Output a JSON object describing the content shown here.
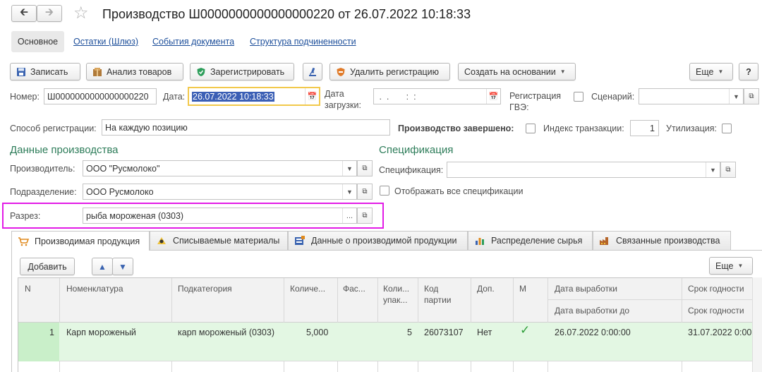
{
  "window": {
    "title": "Производство Ш0000000000000000220 от 26.07.2022 10:18:33"
  },
  "nav": {
    "tabs": [
      "Основное",
      "Остатки (Шлюз)",
      "События документа",
      "Структура подчиненности"
    ]
  },
  "toolbar": {
    "save": "Записать",
    "analyze": "Анализ товаров",
    "register": "Зарегистрировать",
    "unregister": "Удалить регистрацию",
    "create_based": "Создать на основании",
    "more": "Еще",
    "help": "?"
  },
  "form": {
    "number_label": "Номер:",
    "number_value": "Ш0000000000000000220",
    "date_label": "Дата:",
    "date_value": "26.07.2022 10:18:33",
    "load_date_label_1": "Дата",
    "load_date_label_2": "загрузки:",
    "load_date_value": " .  .       :  :",
    "gve_label_1": "Регистрация",
    "gve_label_2": "ГВЭ:",
    "scenario_label": "Сценарий:",
    "scenario_value": "",
    "reg_method_label": "Способ регистрации:",
    "reg_method_value": "На каждую позицию",
    "production_done_label": "Производство завершено:",
    "transaction_index_label": "Индекс транзакции:",
    "transaction_index_value": "1",
    "utilization_label": "Утилизация:"
  },
  "production_section": {
    "title": "Данные производства",
    "producer_label": "Производитель:",
    "producer_value": "ООО \"Русмолоко\"",
    "division_label": "Подразделение:",
    "division_value": "ООО Русмолоко",
    "cut_label": "Разрез:",
    "cut_value": "рыба мороженая (0303)"
  },
  "spec_section": {
    "title": "Спецификация",
    "spec_label": "Спецификация:",
    "spec_value": "",
    "show_all_label": "Отображать все спецификации"
  },
  "bottom_tabs": [
    "Производимая продукция",
    "Списываемые материалы",
    "Данные о производимой продукции",
    "Распределение сырья",
    "Связанные производства"
  ],
  "table_toolbar": {
    "add": "Добавить",
    "more": "Еще"
  },
  "table": {
    "columns": {
      "n": "N",
      "nomenclature": "Номенклатура",
      "subcategory": "Подкатегория",
      "quantity": "Количе...",
      "fas": "Фас...",
      "qty_pack_1": "Коли...",
      "qty_pack_2": "упак...",
      "batch_1": "Код",
      "batch_2": "партии",
      "extra": "Доп.",
      "m": "М",
      "prod_date": "Дата выработки",
      "prod_date_to": "Дата выработки до",
      "expiry": "Срок годности",
      "expiry_to": "Срок годности"
    },
    "rows": [
      {
        "n": "1",
        "nomenclature": "Карп мороженый",
        "subcategory": "карп мороженый (0303)",
        "quantity": "5,000",
        "qty_pack": "5",
        "batch": "26073107",
        "extra": "Нет",
        "prod_date": "26.07.2022 0:00:00",
        "expiry": "31.07.2022 0:00"
      }
    ]
  },
  "colors": {
    "accent_green": "#2e7d5a",
    "highlight_magenta": "#e21ce6",
    "focus_yellow": "#f2c94c",
    "selection_blue": "#3b5fb5",
    "row_green": "#e3f7e3"
  }
}
